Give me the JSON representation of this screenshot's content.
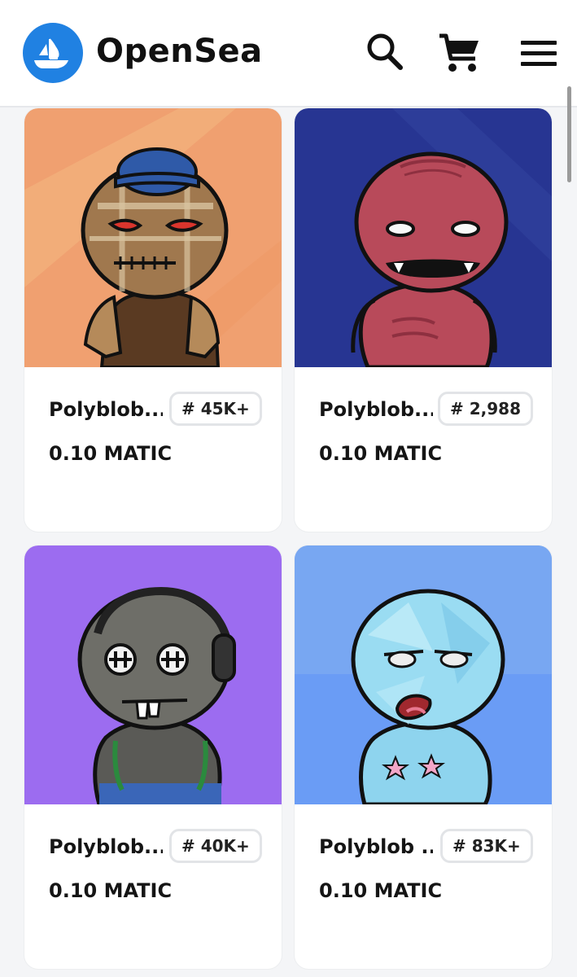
{
  "header": {
    "brand": "OpenSea",
    "icons": {
      "logo": "opensea-logo",
      "search": "search-icon",
      "cart": "cart-icon",
      "menu": "hamburger-menu-icon"
    },
    "colors": {
      "logo_blue": "#2081E2"
    }
  },
  "items": [
    {
      "name": "Polyblob...",
      "rank": "# 45K+",
      "price": "0.10 MATIC",
      "image": "plaid-blob-with-cap",
      "bg": "#F0A070"
    },
    {
      "name": "Polyblob...",
      "rank": "# 2,988",
      "price": "0.10 MATIC",
      "image": "red-blob-with-fangs",
      "bg": "#273592"
    },
    {
      "name": "Polyblob...",
      "rank": "# 40K+",
      "price": "0.10 MATIC",
      "image": "gray-blob-with-headphones",
      "bg": "#9C6CF0"
    },
    {
      "name": "Polyblob ...",
      "rank": "# 83K+",
      "price": "0.10 MATIC",
      "image": "ice-blob-with-stars",
      "bg": "#6A9CF5"
    }
  ]
}
